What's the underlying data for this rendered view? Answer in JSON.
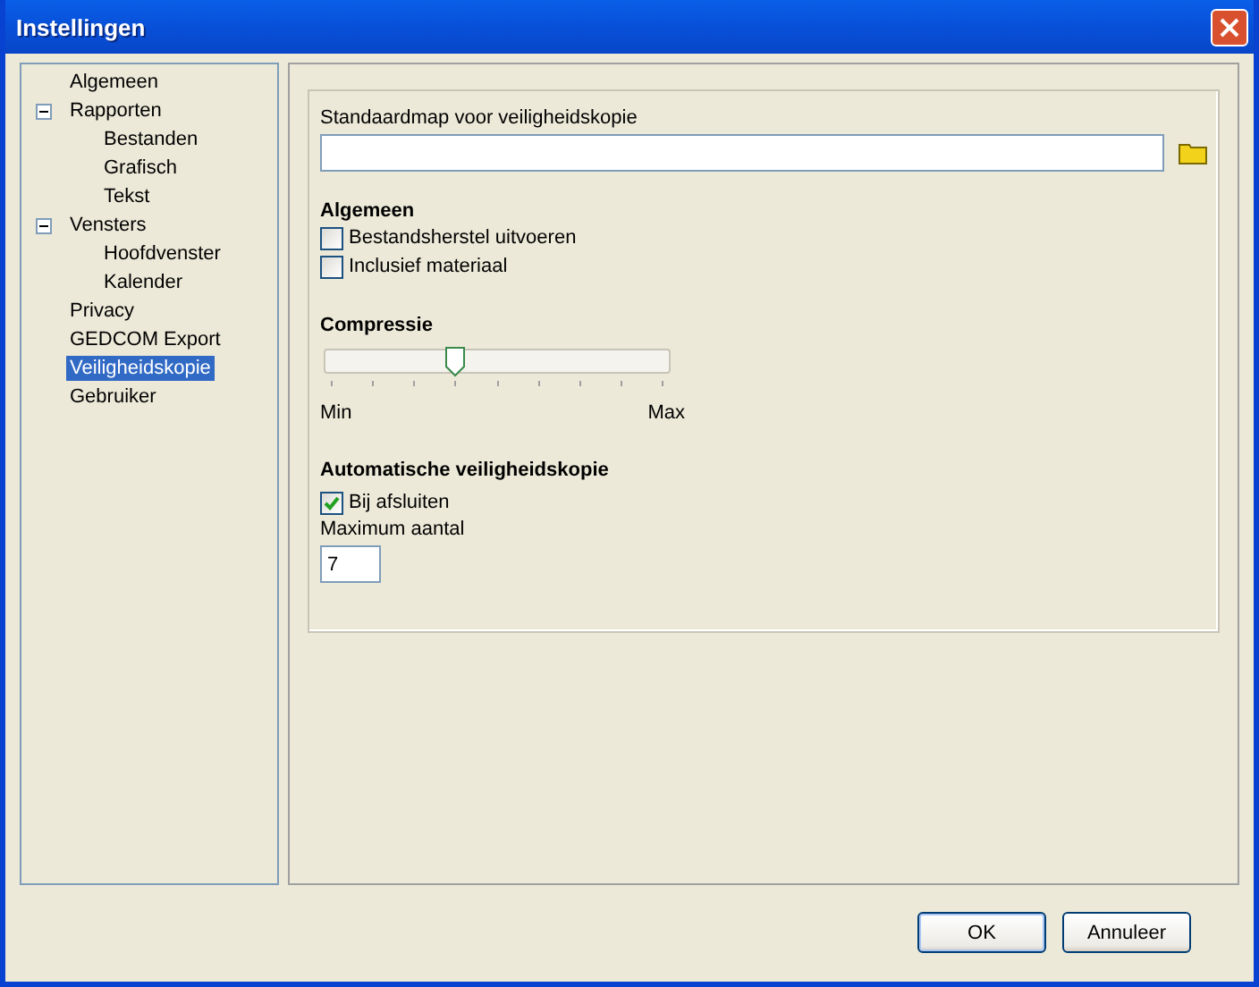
{
  "window": {
    "title": "Instellingen"
  },
  "tree": [
    {
      "label": "Algemeen",
      "selected": false
    },
    {
      "label": "Rapporten",
      "selected": false,
      "expanded": true,
      "children": [
        {
          "label": "Bestanden",
          "selected": false
        },
        {
          "label": "Grafisch",
          "selected": false
        },
        {
          "label": "Tekst",
          "selected": false
        }
      ]
    },
    {
      "label": "Vensters",
      "selected": false,
      "expanded": true,
      "children": [
        {
          "label": "Hoofdvenster",
          "selected": false
        },
        {
          "label": "Kalender",
          "selected": false
        }
      ]
    },
    {
      "label": "Privacy",
      "selected": false
    },
    {
      "label": "GEDCOM Export",
      "selected": false
    },
    {
      "label": "Veiligheidskopie",
      "selected": true
    },
    {
      "label": "Gebruiker",
      "selected": false
    }
  ],
  "folder": {
    "label": "Standaardmap voor veiligheidskopie"
  },
  "general": {
    "heading": "Algemeen",
    "options": [
      {
        "label": "Bestandsherstel uitvoeren",
        "checked": false
      },
      {
        "label": "Inclusief materiaal",
        "checked": false
      }
    ]
  },
  "compression": {
    "heading": "Compressie",
    "level": 0.375,
    "min_label": "Min",
    "max_label": "Max"
  },
  "auto_backup": {
    "heading": "Automatische veiligheidskopie",
    "on_close": {
      "label": "Bij afsluiten",
      "checked": true
    },
    "max_label": "Maximum aantal",
    "max_value": "7"
  },
  "buttons": [
    "OK",
    "Annuleer"
  ]
}
